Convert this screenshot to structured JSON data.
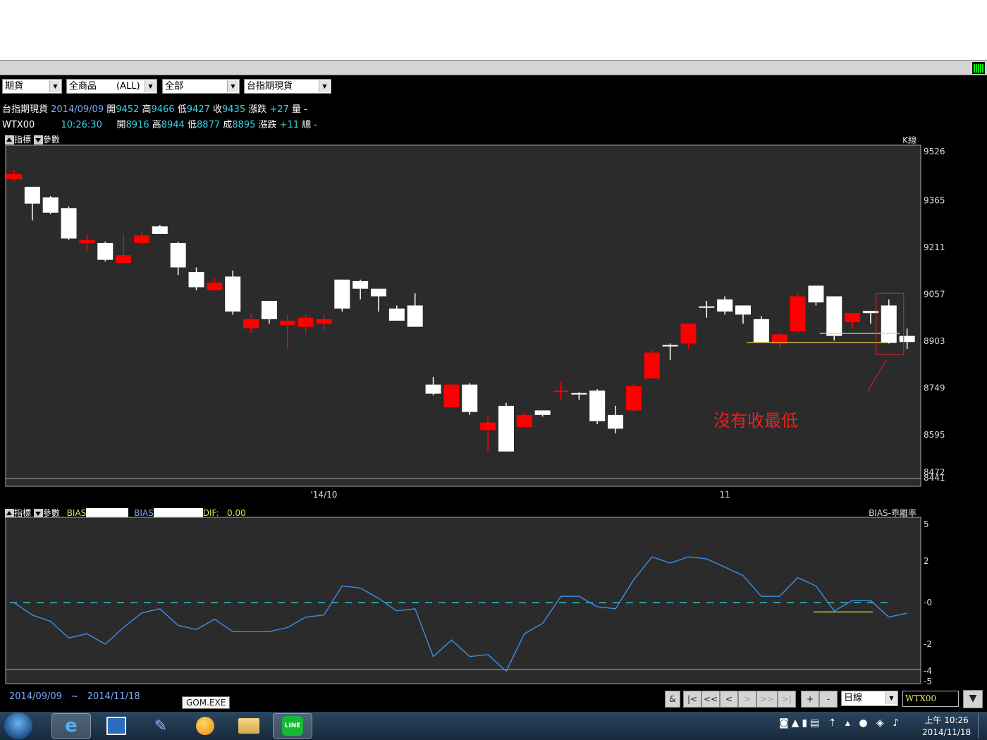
{
  "toolbar": {
    "select1": "期貨",
    "select2_a": "全商品",
    "select2_b": "(ALL)",
    "select3": "全部",
    "select4": "台指期現貨"
  },
  "info_line1": {
    "name": "台指期現貨",
    "date": "2014/09/09",
    "open_label": "開",
    "open": "9452",
    "high_label": "高",
    "high": "9466",
    "low_label": "低",
    "low": "9427",
    "close_label": "收",
    "close": "9435",
    "chg_label": "漲跌",
    "chg": "+27",
    "vol_label": "量",
    "vol": "-"
  },
  "info_line2": {
    "name": "WTX00",
    "time": "10:26:30",
    "open_label": "開",
    "open": "8916",
    "high_label": "高",
    "high": "8944",
    "low_label": "低",
    "low": "8877",
    "close_label": "成",
    "close": "8895",
    "chg_label": "漲跌",
    "chg": "+11",
    "vol_label": "總",
    "vol": "-"
  },
  "panel_toolbar": {
    "indicator": "指標",
    "params": "參數"
  },
  "bias_toolbar": {
    "bias1": "BIAS",
    "bias2": "BIAS",
    "dif": "DIF:",
    "dif_value": "0.00"
  },
  "annotation": "沒有收最低",
  "date_range": {
    "from": "2014/09/09",
    "sep": "~",
    "to": "2014/11/18"
  },
  "nav": {
    "amp": "&",
    "first": "|<",
    "prev_page": "<<",
    "prev": "<",
    "next": ">",
    "next_page": ">>",
    "last": ">|",
    "plus": "+",
    "minus": "-",
    "period": "日線",
    "symbol": "WTX00"
  },
  "tooltip": "GOM.EXE",
  "clock": {
    "time": "上午 10:26",
    "date": "2014/11/18"
  },
  "chart_data": [
    {
      "type": "candlestick",
      "title": "K線",
      "ylim": [
        8441,
        9526
      ],
      "yticks": [
        9526,
        9365,
        9211,
        9057,
        8903,
        8749,
        8595,
        8472,
        8441
      ],
      "xticks": [
        {
          "label": "'14/10",
          "index": 17
        },
        {
          "label": "11",
          "index": 39
        }
      ],
      "colors": {
        "up": "#ffffff",
        "down": "#ff0000",
        "background": "#2b2b2b"
      },
      "candles": [
        {
          "o": 9452,
          "h": 9466,
          "l": 9427,
          "c": 9435
        },
        {
          "o": 9355,
          "h": 9365,
          "l": 9300,
          "c": 9410
        },
        {
          "o": 9325,
          "h": 9380,
          "l": 9320,
          "c": 9375
        },
        {
          "o": 9240,
          "h": 9345,
          "l": 9235,
          "c": 9340
        },
        {
          "o": 9235,
          "h": 9255,
          "l": 9200,
          "c": 9225
        },
        {
          "o": 9170,
          "h": 9230,
          "l": 9165,
          "c": 9225
        },
        {
          "o": 9185,
          "h": 9255,
          "l": 9175,
          "c": 9160
        },
        {
          "o": 9250,
          "h": 9265,
          "l": 9220,
          "c": 9225
        },
        {
          "o": 9255,
          "h": 9285,
          "l": 9255,
          "c": 9280
        },
        {
          "o": 9145,
          "h": 9230,
          "l": 9120,
          "c": 9225
        },
        {
          "o": 9080,
          "h": 9145,
          "l": 9070,
          "c": 9130
        },
        {
          "o": 9095,
          "h": 9110,
          "l": 9070,
          "c": 9070
        },
        {
          "o": 9000,
          "h": 9135,
          "l": 8990,
          "c": 9115
        },
        {
          "o": 8975,
          "h": 8990,
          "l": 8930,
          "c": 8945
        },
        {
          "o": 8975,
          "h": 9020,
          "l": 8960,
          "c": 9035
        },
        {
          "o": 8970,
          "h": 8990,
          "l": 8880,
          "c": 8955
        },
        {
          "o": 8980,
          "h": 8990,
          "l": 8930,
          "c": 8950
        },
        {
          "o": 8975,
          "h": 8990,
          "l": 8935,
          "c": 8960
        },
        {
          "o": 9010,
          "h": 9095,
          "l": 9000,
          "c": 9105
        },
        {
          "o": 9075,
          "h": 9105,
          "l": 9040,
          "c": 9100
        },
        {
          "o": 9050,
          "h": 9070,
          "l": 9000,
          "c": 9075
        },
        {
          "o": 8970,
          "h": 9020,
          "l": 8975,
          "c": 9010
        },
        {
          "o": 8950,
          "h": 9060,
          "l": 8950,
          "c": 9020
        },
        {
          "o": 8730,
          "h": 8785,
          "l": 8725,
          "c": 8760
        },
        {
          "o": 8760,
          "h": 8765,
          "l": 8680,
          "c": 8685
        },
        {
          "o": 8670,
          "h": 8765,
          "l": 8660,
          "c": 8760
        },
        {
          "o": 8635,
          "h": 8660,
          "l": 8540,
          "c": 8610
        },
        {
          "o": 8540,
          "h": 8700,
          "l": 8570,
          "c": 8690
        },
        {
          "o": 8660,
          "h": 8670,
          "l": 8620,
          "c": 8620
        },
        {
          "o": 8660,
          "h": 8675,
          "l": 8655,
          "c": 8675
        },
        {
          "o": 8740,
          "h": 8770,
          "l": 8710,
          "c": 8738
        },
        {
          "o": 8730,
          "h": 8735,
          "l": 8710,
          "c": 8732
        },
        {
          "o": 8640,
          "h": 8745,
          "l": 8630,
          "c": 8740
        },
        {
          "o": 8615,
          "h": 8690,
          "l": 8600,
          "c": 8660
        },
        {
          "o": 8755,
          "h": 8765,
          "l": 8670,
          "c": 8675
        },
        {
          "o": 8865,
          "h": 8875,
          "l": 8865,
          "c": 8780
        },
        {
          "o": 8890,
          "h": 8895,
          "l": 8840,
          "c": 8890
        },
        {
          "o": 8960,
          "h": 8960,
          "l": 8875,
          "c": 8895
        },
        {
          "o": 9015,
          "h": 9035,
          "l": 8980,
          "c": 9017
        },
        {
          "o": 9000,
          "h": 9050,
          "l": 8990,
          "c": 9040
        },
        {
          "o": 8990,
          "h": 9010,
          "l": 8960,
          "c": 9020
        },
        {
          "o": 8900,
          "h": 8985,
          "l": 8900,
          "c": 8975
        },
        {
          "o": 8925,
          "h": 8930,
          "l": 8880,
          "c": 8895
        },
        {
          "o": 9050,
          "h": 9060,
          "l": 8930,
          "c": 8935
        },
        {
          "o": 9030,
          "h": 9085,
          "l": 9020,
          "c": 9085
        },
        {
          "o": 8920,
          "h": 9050,
          "l": 8905,
          "c": 9050
        },
        {
          "o": 8995,
          "h": 8995,
          "l": 8945,
          "c": 8965
        },
        {
          "o": 8995,
          "h": 9000,
          "l": 8960,
          "c": 9002
        },
        {
          "o": 8897,
          "h": 9040,
          "l": 8895,
          "c": 9020
        },
        {
          "o": 8900,
          "h": 8944,
          "l": 8877,
          "c": 8920
        }
      ]
    },
    {
      "type": "line",
      "title": "BIAS-乖離率",
      "ylim": [
        -5,
        5
      ],
      "yticks": [
        5,
        2,
        0,
        -2,
        -4,
        -5
      ],
      "ytick_labels": [
        "5",
        "2",
        "-0",
        "-2",
        "-4",
        "-5"
      ],
      "reference_line": 0,
      "colors": {
        "line": "#3b8ee8",
        "reference": "#35d6e6"
      },
      "values": [
        0,
        -0.6,
        -0.9,
        -1.7,
        -1.5,
        -2.0,
        -1.2,
        -0.5,
        -0.3,
        -1.1,
        -1.3,
        -0.8,
        -1.4,
        -1.4,
        -1.4,
        -1.2,
        -0.7,
        -0.6,
        0.8,
        0.7,
        0.2,
        -0.4,
        -0.3,
        -2.6,
        -1.8,
        -2.6,
        -2.5,
        -3.3,
        -1.5,
        -1.0,
        0.3,
        0.3,
        -0.2,
        -0.3,
        1.1,
        2.2,
        1.9,
        2.2,
        2.1,
        1.7,
        1.3,
        0.3,
        0.3,
        1.2,
        0.8,
        -0.4,
        0.1,
        0.1,
        -0.7,
        -0.5
      ]
    }
  ]
}
